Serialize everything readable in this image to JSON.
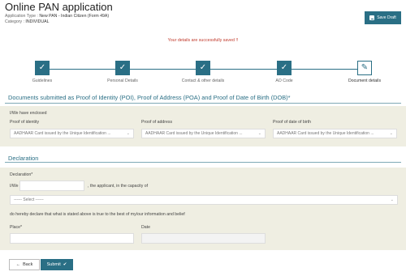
{
  "header": {
    "title": "Online PAN application",
    "application_type_label": "Application Type :",
    "application_type_value": "New PAN - Indian Citizen (Form 49A)",
    "category_label": "Category :",
    "category_value": "INDIVIDUAL",
    "save_draft_label": "Save Draft"
  },
  "status": {
    "message": "Your details are successfully saved !!"
  },
  "stepper": {
    "steps": [
      {
        "label": "Guidelines",
        "state": "done"
      },
      {
        "label": "Personal Details",
        "state": "done"
      },
      {
        "label": "Contact & other details",
        "state": "done"
      },
      {
        "label": "AO Code",
        "state": "done"
      },
      {
        "label": "Document details",
        "state": "current"
      }
    ],
    "check_glyph": "✓",
    "current_glyph": "✎"
  },
  "documents": {
    "title": "Documents submitted as Proof of Identity (POI), Proof of Address (POA) and Proof of Date of Birth (DOB)*",
    "enclosed_label": "I/We have enclosed",
    "poi_label": "Proof of identity",
    "poi_value": "AADHAAR Card issued by the Unique Identification ...",
    "poa_label": "Proof of address",
    "poa_value": "AADHAAR Card issued by the Unique Identification ...",
    "dob_label": "Proof of date of birth",
    "dob_value": "AADHAAR Card issued by the Unique Identification ..."
  },
  "declaration": {
    "title": "Declaration",
    "declaration_label": "Declaration*",
    "iwe_label": "I/We",
    "iwe_value": "",
    "capacity_text": ", the applicant, in the capacity of",
    "capacity_select": "------ Select ------",
    "statement": "do hereby declare that what is stated above is true to the best of my/our information and belief",
    "place_label": "Place*",
    "place_value": "",
    "date_label": "Date",
    "date_value": ""
  },
  "actions": {
    "back_label": "Back",
    "submit_label": "Submit",
    "back_glyph": "←",
    "submit_glyph": "✔"
  },
  "colors": {
    "accent": "#2a6f85",
    "panel": "#efeee2",
    "success_text": "#c0392b"
  }
}
